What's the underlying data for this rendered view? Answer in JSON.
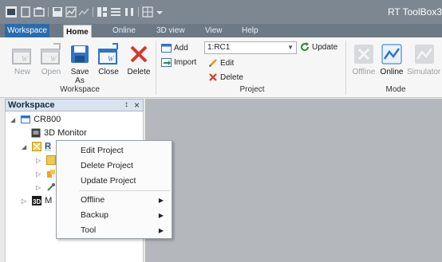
{
  "window": {
    "title": "RT ToolBox3"
  },
  "ribbon_tabs": [
    {
      "label": "Workspace"
    },
    {
      "label": "Home"
    },
    {
      "label": "Online"
    },
    {
      "label": "3D view"
    },
    {
      "label": "View"
    },
    {
      "label": "Help"
    }
  ],
  "workspace_group": {
    "label": "Workspace",
    "buttons": [
      {
        "label": "New",
        "enabled": false
      },
      {
        "label": "Open",
        "enabled": false
      },
      {
        "label": "Save As",
        "enabled": true
      },
      {
        "label": "Close",
        "enabled": true
      },
      {
        "label": "Delete",
        "enabled": true
      }
    ]
  },
  "project_group": {
    "label": "Project",
    "add_label": "Add",
    "import_label": "Import",
    "selected_project": "1:RC1",
    "update_label": "Update",
    "edit_label": "Edit",
    "delete_label": "Delete"
  },
  "mode_group": {
    "label": "Mode",
    "buttons": [
      {
        "label": "Offline"
      },
      {
        "label": "Online"
      },
      {
        "label": "Simulator"
      }
    ]
  },
  "workspace_panel": {
    "title": "Workspace",
    "pin_glyph": "↕",
    "close_glyph": "×",
    "tree": {
      "root": "CR800",
      "monitor": "3D Monitor",
      "rc_partial": "R",
      "model_partial": "M"
    }
  },
  "context_menu": {
    "items": [
      {
        "label": "Edit Project",
        "submenu": false
      },
      {
        "label": "Delete Project",
        "submenu": false
      },
      {
        "label": "Update Project",
        "submenu": false
      },
      {
        "label": "Offline",
        "submenu": true
      },
      {
        "label": "Backup",
        "submenu": true
      },
      {
        "label": "Tool",
        "submenu": true
      }
    ]
  },
  "colors": {
    "title_bar": "#7d8792",
    "file_tab": "#2b6cae",
    "ribbon_bg": "#f6f6f6",
    "doc_area": "#b4b7bb",
    "delete_red": "#d23b2a",
    "save_blue": "#2f73c8"
  }
}
